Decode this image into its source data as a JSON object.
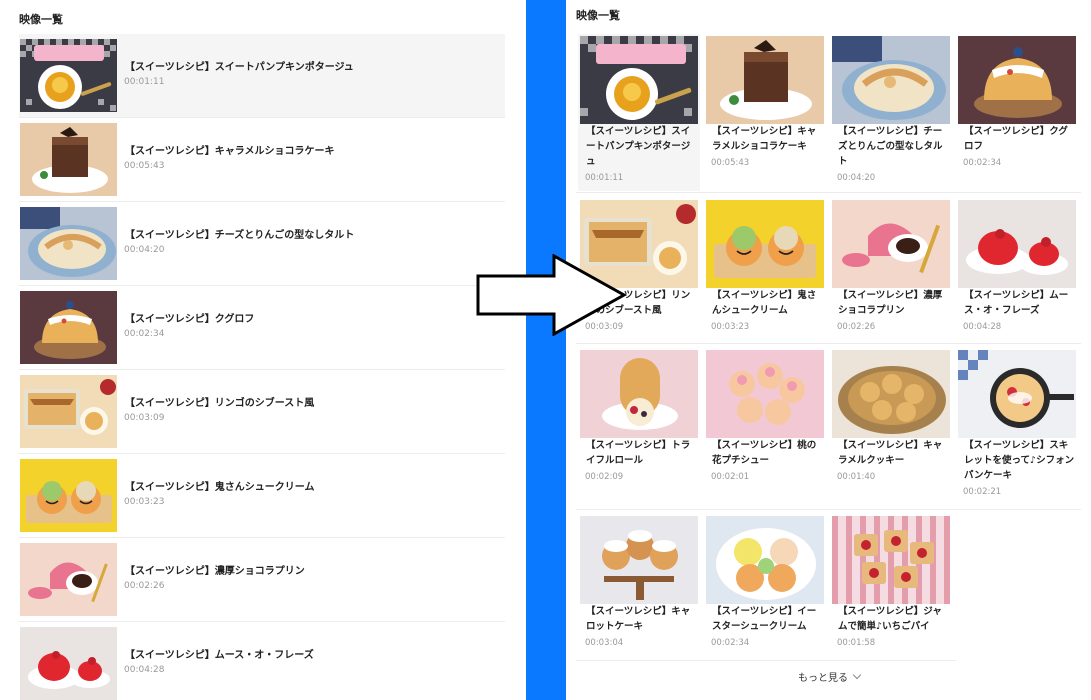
{
  "left_panel": {
    "title": "映像一覧",
    "items": [
      {
        "title": "【スイーツレシピ】スイートパンプキンポタージュ",
        "duration": "00:01:11"
      },
      {
        "title": "【スイーツレシピ】キャラメルショコラケーキ",
        "duration": "00:05:43"
      },
      {
        "title": "【スイーツレシピ】チーズとりんごの型なしタルト",
        "duration": "00:04:20"
      },
      {
        "title": "【スイーツレシピ】クグロフ",
        "duration": "00:02:34"
      },
      {
        "title": "【スイーツレシピ】リンゴのシブースト風",
        "duration": "00:03:09"
      },
      {
        "title": "【スイーツレシピ】鬼さんシュークリーム",
        "duration": "00:03:23"
      },
      {
        "title": "【スイーツレシピ】濃厚ショコラプリン",
        "duration": "00:02:26"
      },
      {
        "title": "【スイーツレシピ】ムース・オ・フレーズ",
        "duration": "00:04:28"
      }
    ]
  },
  "right_panel": {
    "title": "映像一覧",
    "cards": [
      {
        "title": "【スイーツレシピ】スイートパンプキンポタージュ",
        "duration": "00:01:11"
      },
      {
        "title": "【スイーツレシピ】キャラメルショコラケーキ",
        "duration": "00:05:43"
      },
      {
        "title": "【スイーツレシピ】チーズとりんごの型なしタルト",
        "duration": "00:04:20"
      },
      {
        "title": "【スイーツレシピ】クグロフ",
        "duration": "00:02:34"
      },
      {
        "title": "【スイーツレシピ】リンゴのシブースト風",
        "duration": "00:03:09"
      },
      {
        "title": "【スイーツレシピ】鬼さんシュークリーム",
        "duration": "00:03:23"
      },
      {
        "title": "【スイーツレシピ】濃厚ショコラプリン",
        "duration": "00:02:26"
      },
      {
        "title": "【スイーツレシピ】ムース・オ・フレーズ",
        "duration": "00:04:28"
      },
      {
        "title": "【スイーツレシピ】トライフルロール",
        "duration": "00:02:09"
      },
      {
        "title": "【スイーツレシピ】桃の花プチシュー",
        "duration": "00:02:01"
      },
      {
        "title": "【スイーツレシピ】キャラメルクッキー",
        "duration": "00:01:40"
      },
      {
        "title": "【スイーツレシピ】スキレットを使って♪シフォンパンケーキ",
        "duration": "00:02:21"
      },
      {
        "title": "【スイーツレシピ】キャロットケーキ",
        "duration": "00:03:04"
      },
      {
        "title": "【スイーツレシピ】イースターシュークリーム",
        "duration": "00:02:34"
      },
      {
        "title": "【スイーツレシピ】ジャムで簡単♪いちごパイ",
        "duration": "00:01:58"
      }
    ],
    "more_label": "もっと見る"
  },
  "colors": {
    "divider": "#0a78ff",
    "active_row": "#f5f5f5",
    "duration_text": "#999999"
  },
  "icons": {
    "arrow": "right-arrow-outline-icon",
    "more_chevron": "chevron-down-icon"
  }
}
